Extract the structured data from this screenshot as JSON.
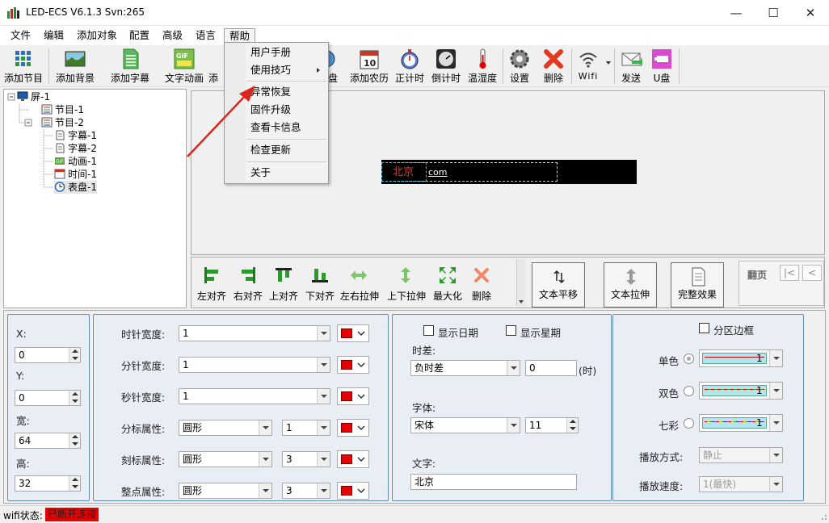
{
  "window": {
    "title": "LED-ECS V6.1.3 Svn:265"
  },
  "menu": {
    "items": [
      "文件",
      "编辑",
      "添加对象",
      "配置",
      "高级",
      "语言",
      "帮助"
    ]
  },
  "help_menu": {
    "items": [
      "用户手册",
      "使用技巧",
      "异常恢复",
      "固件升级",
      "查看卡信息",
      "检查更新",
      "关于"
    ]
  },
  "toolbar": {
    "items": [
      "添加节目",
      "添加背景",
      "添加字幕",
      "文字动画",
      "添",
      "盘",
      "添加农历",
      "正计时",
      "倒计时",
      "温湿度",
      "设置",
      "删除",
      "Wifi",
      "发送",
      "U盘"
    ]
  },
  "tree": {
    "root": "屏-1",
    "nodes": [
      "节目-1",
      "节目-2",
      "字幕-1",
      "字幕-2",
      "动画-1",
      "时间-1",
      "表盘-1"
    ]
  },
  "preview": {
    "led_text": "北京",
    "led_suffix": "com"
  },
  "align": {
    "items": [
      "左对齐",
      "右对齐",
      "上对齐",
      "下对齐",
      "左右拉伸",
      "上下拉伸",
      "最大化",
      "删除"
    ]
  },
  "text_buttons": {
    "pan": "文本平移",
    "stretch": "文本拉伸",
    "full": "完整效果",
    "page": "翻页",
    "first": "|<",
    "prev": "<"
  },
  "position": {
    "x_label": "X:",
    "x": "0",
    "y_label": "Y:",
    "y": "0",
    "w_label": "宽:",
    "w": "64",
    "h_label": "高:",
    "h": "32"
  },
  "clock": {
    "hour_width_label": "时针宽度:",
    "hour_width": "1",
    "minute_width_label": "分针宽度:",
    "minute_width": "1",
    "second_width_label": "秒针宽度:",
    "second_width": "1",
    "minute_mark_label": "分标属性:",
    "minute_mark_shape": "圆形",
    "minute_mark_size": "1",
    "scale_mark_label": "刻标属性:",
    "scale_mark_shape": "圆形",
    "scale_mark_size": "3",
    "hour_mark_label": "整点属性:",
    "hour_mark_shape": "圆形",
    "hour_mark_size": "3",
    "color": "#e60000"
  },
  "text_panel": {
    "show_date": "显示日期",
    "show_week": "显示星期",
    "tz_label": "时差:",
    "tz_sign": "负时差",
    "tz_value": "0",
    "tz_unit": "(时)",
    "font_label": "字体:",
    "font": "宋体",
    "font_size": "11",
    "text_label": "文字:",
    "text": "北京"
  },
  "border_panel": {
    "title": "分区边框",
    "single": "单色",
    "double": "双色",
    "seven": "七彩",
    "single_value": "1",
    "double_value": "1",
    "seven_value": "1",
    "mode_label": "播放方式:",
    "mode": "静止",
    "speed_label": "播放速度:",
    "speed": "1(最快)"
  },
  "status": {
    "label": "wifi状态:",
    "value": "已断开连接",
    "value_color": "#e60000"
  }
}
